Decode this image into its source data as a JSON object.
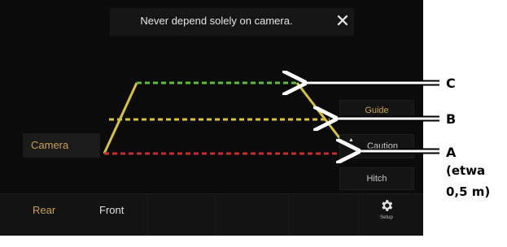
{
  "warning": {
    "text": "Never depend solely on camera.",
    "close_icon": "close-icon"
  },
  "side_buttons": {
    "guide": "Guide",
    "caution": "Caution",
    "hitch": "Hitch"
  },
  "camera_button": "Camera",
  "bottom_tabs": {
    "rear": "Rear",
    "front": "Front"
  },
  "setup": {
    "label": "Setup",
    "icon": "gear-icon"
  },
  "callouts": {
    "c": "C",
    "b": "B",
    "a": "A",
    "a_note_line1": "(etwa",
    "a_note_line2": "0,5 m)"
  },
  "colors": {
    "guide_green": "#5bbf3a",
    "guide_yellow": "#d7c23a",
    "guide_red": "#c8302a",
    "accent_gold": "#c9a24b"
  }
}
